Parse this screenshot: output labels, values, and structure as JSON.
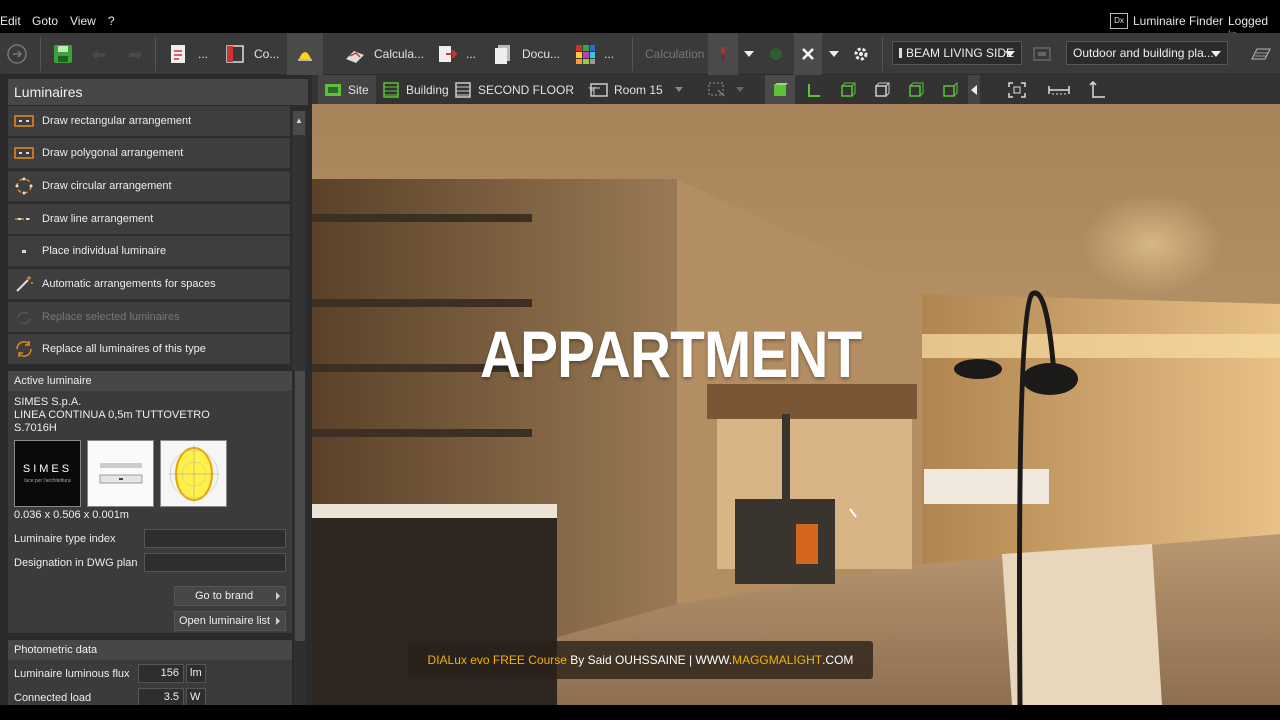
{
  "menu": {
    "items": [
      "Edit",
      "Goto",
      "View",
      "?"
    ],
    "luminaire_finder": "Luminaire Finder",
    "logged_in": "Logged in"
  },
  "toolbar": {
    "co_label": "Co...",
    "calcula_label": "Calcula...",
    "docu_label": "Docu...",
    "dots1": "...",
    "dots2": "...",
    "dots3": "...",
    "calculation_label": "Calculation",
    "scene_select": "BEAM LIVING SIDE",
    "profile_select": "Outdoor and building pla..."
  },
  "toolbar2": {
    "site": "Site",
    "building": "Building",
    "floor": "SECOND FLOOR",
    "room": "Room 15"
  },
  "panel": {
    "title": "Luminaires",
    "items": [
      {
        "label": "Draw rectangular arrangement",
        "enabled": true
      },
      {
        "label": "Draw polygonal arrangement",
        "enabled": true
      },
      {
        "label": "Draw circular arrangement",
        "enabled": true
      },
      {
        "label": "Draw line arrangement",
        "enabled": true
      },
      {
        "label": "Place individual luminaire",
        "enabled": true
      },
      {
        "label": "Automatic arrangements for spaces",
        "enabled": true
      },
      {
        "label": "Replace selected luminaires",
        "enabled": false
      },
      {
        "label": "Replace all luminaires of this type",
        "enabled": true
      }
    ]
  },
  "active_luminaire": {
    "header": "Active luminaire",
    "manufacturer": "SIMES S.p.A.",
    "name": "LINEA CONTINUA 0,5m TUTTOVETRO",
    "code": "S.7016H",
    "logo_text": "SIMES",
    "logo_sub": "luce per l'architettura",
    "dimensions": "0.036 x 0.506 x 0.001m",
    "type_index_label": "Luminaire type index",
    "dwg_label": "Designation in DWG plan",
    "brand_button": "Go to brand",
    "list_button": "Open luminaire list"
  },
  "photometric": {
    "header": "Photometric data",
    "flux_label": "Luminaire luminous flux",
    "flux_value": "156",
    "flux_unit": "lm",
    "load_label": "Connected load",
    "load_value": "3.5",
    "load_unit": "W"
  },
  "overlay": {
    "title": "APPARTMENT",
    "caption_course": "DIALux evo FREE Course",
    "caption_by": " By Said OUHSSAINE | WWW.",
    "caption_brand": "MAGGMALIGHT",
    "caption_tail": ".COM"
  },
  "colors": {
    "accent_green": "#5fc13a",
    "caption_yellow": "#f2b400",
    "panel_bg": "#2b2b2b"
  }
}
